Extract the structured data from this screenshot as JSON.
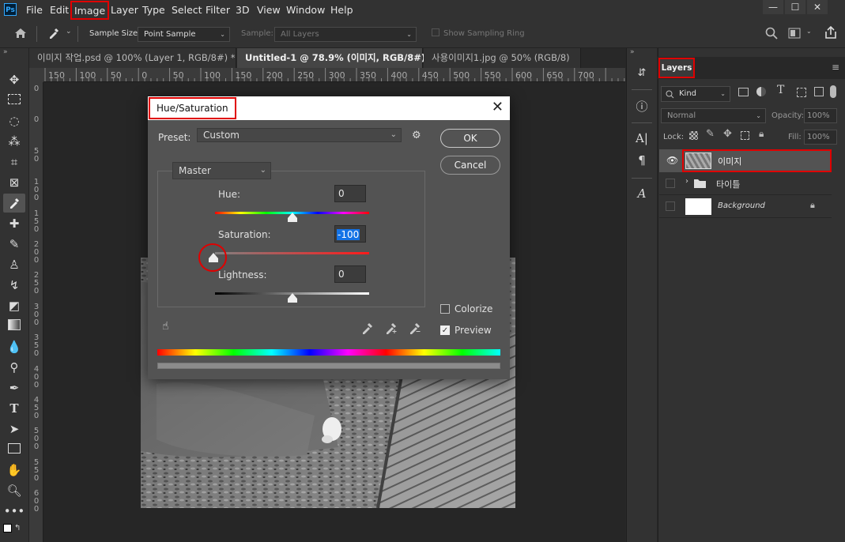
{
  "app": {
    "logo": "Ps"
  },
  "menu": {
    "items": [
      "File",
      "Edit",
      "Image",
      "Layer",
      "Type",
      "Select",
      "Filter",
      "3D",
      "View",
      "Window",
      "Help"
    ],
    "highlighted": "Image"
  },
  "window_controls": {
    "minimize": "—",
    "maximize": "☐",
    "close": "✕"
  },
  "options": {
    "sample_size_label": "Sample Size:",
    "sample_size_value": "Point Sample",
    "sample_label": "Sample:",
    "sample_value": "All Layers",
    "show_ring_label": "Show Sampling Ring"
  },
  "tabs": [
    {
      "label": "이미지 작업.psd @ 100% (Layer 1, RGB/8#) *",
      "active": false
    },
    {
      "label": "Untitled-1 @ 78.9% (이미지, RGB/8#) *",
      "active": true
    },
    {
      "label": "사용이미지1.jpg @ 50% (RGB/8)",
      "active": false
    }
  ],
  "tab_close": "×",
  "ruler": {
    "h_labels": [
      "150",
      "100",
      "50",
      "0",
      "50",
      "100",
      "150",
      "200",
      "250",
      "300",
      "350",
      "400",
      "450",
      "500",
      "550",
      "600",
      "650",
      "700"
    ],
    "v_labels": [
      [
        "0"
      ],
      [
        "0"
      ],
      [
        "5",
        "0"
      ],
      [
        "1",
        "0",
        "0"
      ],
      [
        "1",
        "5",
        "0"
      ],
      [
        "2",
        "0",
        "0"
      ],
      [
        "2",
        "5",
        "0"
      ],
      [
        "3",
        "0",
        "0"
      ],
      [
        "3",
        "5",
        "0"
      ],
      [
        "4",
        "0",
        "0"
      ],
      [
        "4",
        "5",
        "0"
      ],
      [
        "5",
        "0",
        "0"
      ],
      [
        "5",
        "5",
        "0"
      ],
      [
        "6",
        "0",
        "0"
      ]
    ]
  },
  "dialog": {
    "title": "Hue/Saturation",
    "preset_label": "Preset:",
    "preset_value": "Custom",
    "channel": "Master",
    "hue_label": "Hue:",
    "hue_value": "0",
    "saturation_label": "Saturation:",
    "saturation_value": "-100",
    "lightness_label": "Lightness:",
    "lightness_value": "0",
    "ok": "OK",
    "cancel": "Cancel",
    "colorize_label": "Colorize",
    "colorize_checked": false,
    "preview_label": "Preview",
    "preview_checked": true,
    "slider_positions": {
      "hue": 0.5,
      "saturation": 0.0,
      "lightness": 0.5
    }
  },
  "layers_panel": {
    "tab": "Layers",
    "filter_kind": "Kind",
    "blend_mode": "Normal",
    "opacity_label": "Opacity:",
    "opacity_value": "100%",
    "lock_label": "Lock:",
    "fill_label": "Fill:",
    "fill_value": "100%",
    "layers": [
      {
        "name": "이미지",
        "visible": true,
        "selected": true
      },
      {
        "name": "타이틀",
        "visible": false,
        "group": true
      },
      {
        "name": "Background",
        "visible": false,
        "locked": true
      }
    ]
  },
  "colors": {
    "highlight": "#e00000",
    "accent": "#1473e6"
  }
}
